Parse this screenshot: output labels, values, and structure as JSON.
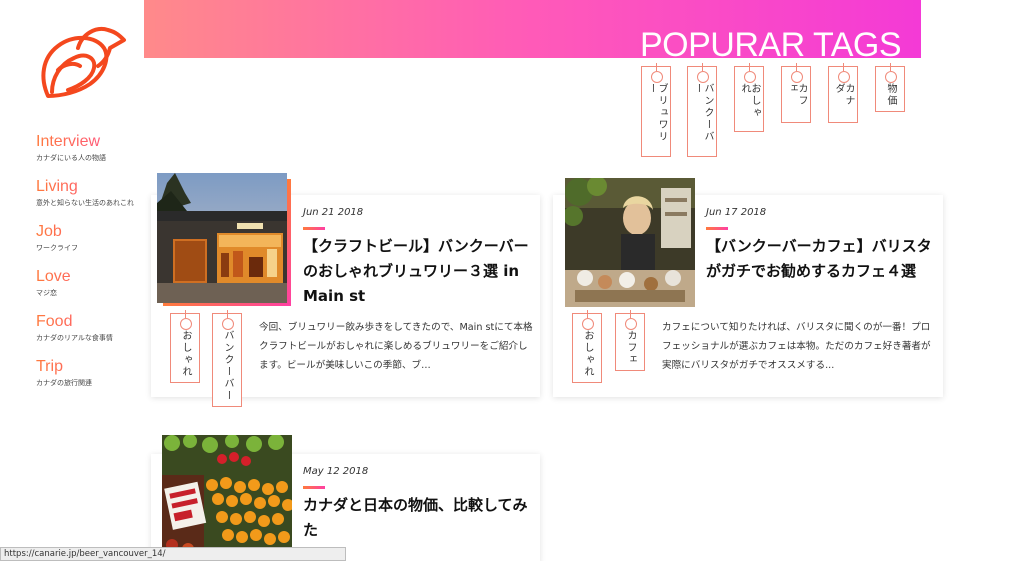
{
  "header": {
    "title": "POPURAR TAGS"
  },
  "nav": [
    {
      "label": "Interview",
      "sub": "カナダにいる人の物語"
    },
    {
      "label": "Living",
      "sub": "意外と知らない生活のあれこれ"
    },
    {
      "label": "Job",
      "sub": "ワークライフ"
    },
    {
      "label": "Love",
      "sub": "マジ恋"
    },
    {
      "label": "Food",
      "sub": "カナダのリアルな食事情"
    },
    {
      "label": "Trip",
      "sub": "カナダの旅行関連"
    }
  ],
  "popular_tags": [
    "ブリュワリー",
    "バンクーバー",
    "おしゃれ",
    "カフェ",
    "カナダ",
    "物価"
  ],
  "posts": [
    {
      "date": "Jun 21 2018",
      "title": "【クラフトビール】バンクーバーのおしゃれブリュワリー３選 in Main st",
      "excerpt": "今回、ブリュワリー飲み歩きをしてきたので、Main stにて本格クラフトビールがおしゃれに楽しめるブリュワリーをご紹介します。ビールが美味しいこの季節、ブ…",
      "tags": [
        "おしゃれ",
        "バンクーバー"
      ]
    },
    {
      "date": "Jun 17 2018",
      "title": "【バンクーバーカフェ】バリスタがガチでお勧めするカフェ４選",
      "excerpt": "カフェについて知りたければ、バリスタに聞くのが一番！プロフェッショナルが選ぶカフェは本物。ただのカフェ好き著者が実際にバリスタがガチでオススメする...",
      "tags": [
        "おしゃれ",
        "カフェ"
      ]
    },
    {
      "date": "May 12 2018",
      "title": "カナダと日本の物価、比較してみた",
      "excerpt": "",
      "tags": []
    }
  ],
  "status_bar": {
    "url": "https://canarie.jp/beer_vancouver_14/"
  },
  "colors": {
    "accent_start": "#ff7a3d",
    "accent_end": "#ff3fa4",
    "tag_border": "#f08a7a"
  }
}
